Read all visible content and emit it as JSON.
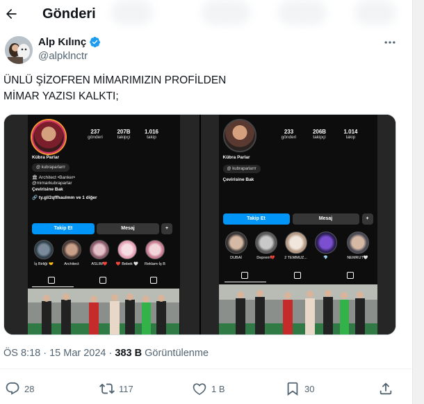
{
  "header": {
    "title": "Gönderi"
  },
  "author": {
    "name": "Alp Kılınç",
    "handle": "@alpklnctr"
  },
  "tweet": {
    "lines": [
      "ÜNLÜ ŞİZOFREN MİMARIMIZIN PROFİLDEN",
      "MİMAR YAZISI KALKTI;"
    ]
  },
  "screenshot_left": {
    "stats": [
      {
        "num": "237",
        "label": "gönderi"
      },
      {
        "num": "207B",
        "label": "takipçi"
      },
      {
        "num": "1.016",
        "label": "takip"
      }
    ],
    "name": "Kübra Parlar",
    "threads": "kubraparlarrr",
    "bio1": "🏛 Architect •Banker•",
    "bio2": "@mimarkubraparlar",
    "translate": "Çevirisine Bak",
    "link": "🔗 ty.gl/2qffhaulmm ve 1 diğer",
    "follow": "Takip Et",
    "message": "Mesaj",
    "highlights": [
      "İş Birliği 🤝",
      "Architect",
      "ASLIM❤️",
      "❤️ Bebek 🤍",
      "Reklam-İş B"
    ]
  },
  "screenshot_right": {
    "stats": [
      {
        "num": "233",
        "label": "gönderi"
      },
      {
        "num": "206B",
        "label": "takipçi"
      },
      {
        "num": "1.014",
        "label": "takip"
      }
    ],
    "name": "Kübra Parlar",
    "threads": "kubraparlarrr",
    "translate": "Çevirisine Bak",
    "follow": "Takip Et",
    "message": "Mesaj",
    "highlights": [
      "DUBAİ",
      "Deprem💔",
      "2 TEMMUZ...",
      "💎",
      "NEMRUT🤍"
    ]
  },
  "meta": {
    "time": "ÖS 8:18 · 15 Mar 2024 · ",
    "views": "383 B",
    "views_label": " Görüntülenme"
  },
  "actions": {
    "replies": "28",
    "reposts": "117",
    "likes": "1 B",
    "bookmarks": "30"
  },
  "colors": {
    "accent": "#1d9bf0",
    "text": "#0f1419",
    "muted": "#536471",
    "ig_blue": "#0095f6"
  },
  "icons": [
    "back-arrow-icon",
    "verified-icon",
    "more-icon",
    "reply-icon",
    "repost-icon",
    "like-icon",
    "bookmark-icon",
    "share-icon"
  ]
}
